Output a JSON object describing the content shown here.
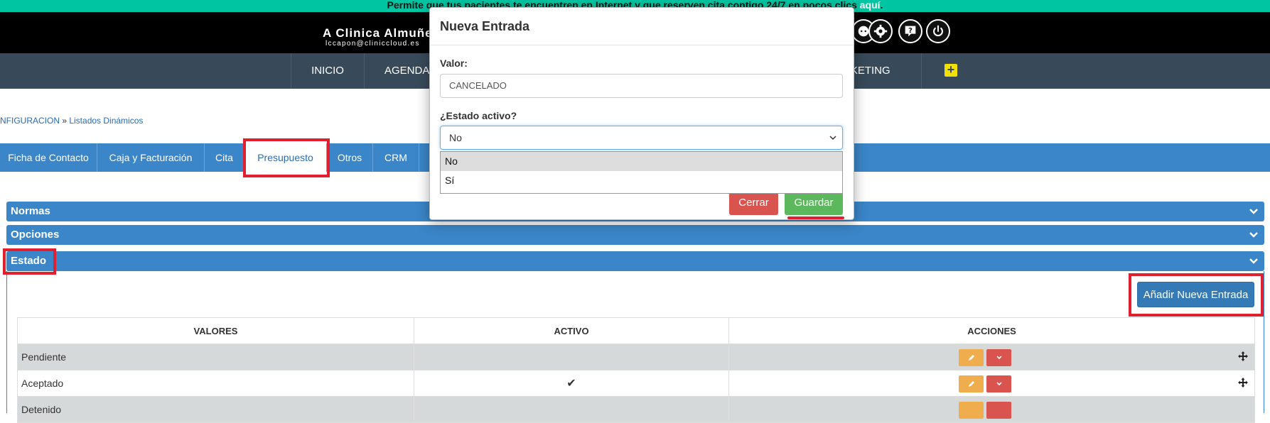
{
  "promo": {
    "text": "Permite que tus pacientes te encuentren en Internet y que reserven cita contigo 24/7 en pocos clics ",
    "link": "aquí",
    "end": "."
  },
  "header": {
    "clinic_name": "A Clinica Almuñe",
    "email": "lccapon@cliniccloud.es"
  },
  "nav": {
    "items": [
      "INICIO",
      "AGENDA",
      "RKETING"
    ],
    "plus": "+"
  },
  "breadcrumb": {
    "first": "NFIGURACION",
    "sep": " » ",
    "second": "Listados Dinámicos"
  },
  "tabs": [
    "Ficha de Contacto",
    "Caja y Facturación",
    "Cita",
    "Presupuesto",
    "Otros",
    "CRM"
  ],
  "panels": {
    "normas": "Normas",
    "opciones": "Opciones",
    "estado": "Estado"
  },
  "add_button": "Añadir Nueva Entrada",
  "table": {
    "headers": [
      "VALORES",
      "ACTIVO",
      "ACCIONES"
    ],
    "rows": [
      {
        "valor": "Pendiente",
        "activo": ""
      },
      {
        "valor": "Aceptado",
        "activo": "✔"
      },
      {
        "valor": "Detenido",
        "activo": ""
      }
    ]
  },
  "modal": {
    "title": "Nueva Entrada",
    "valor_label": "Valor:",
    "valor_value": "CANCELADO",
    "estado_label": "¿Estado activo?",
    "estado_selected": "No",
    "options": [
      "No",
      "Sí"
    ],
    "close_label": "Cerrar",
    "save_label": "Guardar"
  },
  "colors": {
    "accent": "#3a86c8",
    "nav": "#384a59",
    "promo": "#00c5a2",
    "highlight": "#e0202e"
  }
}
